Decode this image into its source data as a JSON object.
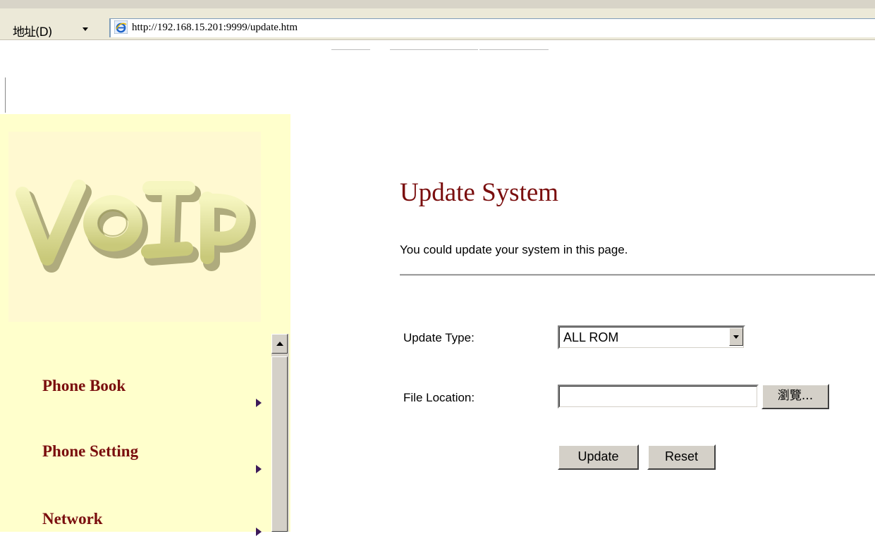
{
  "browser": {
    "address_label": "地址(D)",
    "url": "http://192.168.15.201:9999/update.htm"
  },
  "sidebar": {
    "logo_text": "VoIP",
    "items": [
      {
        "label": "Phone Book"
      },
      {
        "label": "Phone Setting"
      },
      {
        "label": "Network"
      }
    ]
  },
  "main": {
    "title": "Update System",
    "subtitle": "You could update your system in this page.",
    "update_type_label": "Update Type:",
    "update_type_value": "ALL ROM",
    "file_location_label": "File Location:",
    "file_location_value": "",
    "browse_label": "瀏覽...",
    "update_button": "Update",
    "reset_button": "Reset"
  },
  "colors": {
    "sidebar_bg": "#ffffcc",
    "accent": "#7a0e0e",
    "logo_fill": "#e8e8a0"
  }
}
